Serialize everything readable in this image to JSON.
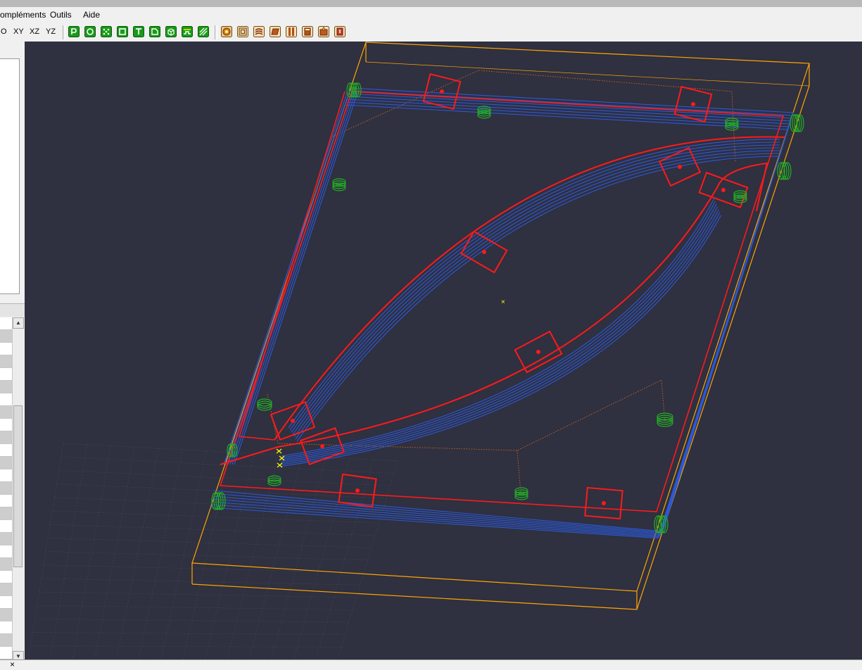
{
  "menu": {
    "items": [
      {
        "label": "ompléments"
      },
      {
        "label": "Outils"
      },
      {
        "label": "Aide"
      }
    ]
  },
  "toolbar": {
    "views": [
      {
        "label": "O"
      },
      {
        "label": "XY"
      },
      {
        "label": "XZ"
      },
      {
        "label": "YZ"
      }
    ],
    "icons": [
      "profile-icon",
      "circle-pocket-icon",
      "drill-points-icon",
      "square-pocket-icon",
      "text-engrave-icon",
      "drawing-icon",
      "3d-box-icon",
      "tabs-icon",
      "hatch-icon",
      "toolpath-simulate-icon",
      "contour-offset-icon",
      "layers-icon",
      "material-block-icon",
      "tool-library-icon",
      "calculator-icon",
      "export-icon",
      "postprocessor-icon"
    ]
  },
  "bottom": {
    "close_label": "×"
  },
  "viewport": {
    "origin_marker": "×"
  },
  "colors": {
    "background": "#2f3040",
    "stock_outline": "#ffa500",
    "toolpath_passes": "#2b59d6",
    "contour": "#ff1a1a",
    "ramp_entries": "#22b022",
    "guide_lines": "#d2691e",
    "origin": "#ffff00"
  }
}
